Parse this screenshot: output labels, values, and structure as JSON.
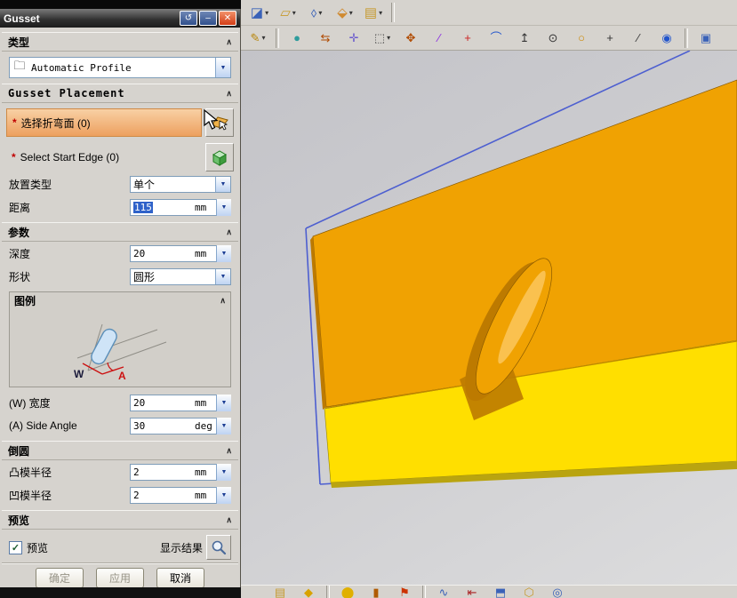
{
  "window": {
    "title": "Gusset"
  },
  "titlebar": {
    "rollback": "↺",
    "minimize": "–",
    "close": "✕"
  },
  "icons": {
    "collapse": "∧",
    "spinner": "▼",
    "check": "✓"
  },
  "dialog": {
    "sections": {
      "type": {
        "header": "类型"
      },
      "placement": {
        "header": "Gusset Placement"
      },
      "parameters": {
        "header": "参数"
      },
      "fillet": {
        "header": "倒圆"
      },
      "preview": {
        "header": "预览"
      }
    },
    "type_combo": {
      "value": "Automatic Profile"
    },
    "select_bend_face": {
      "marker": "*",
      "label": "选择折弯面 (0)"
    },
    "select_start_edge": {
      "marker": "*",
      "label": "Select Start Edge (0)"
    },
    "placement_type": {
      "label": "放置类型",
      "value": "单个"
    },
    "distance": {
      "label": "距离",
      "value": "115",
      "unit": "mm"
    },
    "depth": {
      "label": "深度",
      "value": "20",
      "unit": "mm"
    },
    "shape": {
      "label": "形状",
      "value": "圆形"
    },
    "legend": {
      "label": "图例",
      "w_letter": "W",
      "a_letter": "A"
    },
    "width": {
      "label": "(W) 宽度",
      "value": "20",
      "unit": "mm"
    },
    "side_angle": {
      "label": "(A) Side Angle",
      "value": "30",
      "unit": "deg"
    },
    "punch_radius": {
      "label": "凸模半径",
      "value": "2",
      "unit": "mm"
    },
    "die_radius": {
      "label": "凹模半径",
      "value": "2",
      "unit": "mm"
    },
    "preview_check": {
      "label": "预览"
    },
    "show_result": {
      "label": "显示结果"
    },
    "buttons": {
      "ok": "确定",
      "apply": "应用",
      "cancel": "取消"
    }
  },
  "colors": {
    "face_orange": "#f0a202",
    "face_yellow": "#ffdf00",
    "gusset_dark": "#bd7a00",
    "gusset_highlight": "#ffd27a",
    "edge_blue": "#4d5fd0",
    "thickness": "#b9a410",
    "bend_line": "#c08a00",
    "edge_dark": "#8a5a00"
  },
  "toolbar1": {
    "items": [
      {
        "name": "task-environment-icon",
        "glyph": "◪",
        "color": "#3a62b8",
        "arrow": true
      },
      {
        "name": "datum-plane-icon",
        "glyph": "▱",
        "color": "#c69a2e",
        "arrow": true
      },
      {
        "name": "datum-csys-icon",
        "glyph": "⬨",
        "color": "#3a62b8",
        "arrow": true
      },
      {
        "name": "extrude-icon",
        "glyph": "⬙",
        "color": "#d08a30",
        "arrow": true
      },
      {
        "name": "sheet-stack-icon",
        "glyph": "▤",
        "color": "#c69a2e",
        "arrow": true
      },
      {
        "sep": true
      }
    ]
  },
  "toolbar2": {
    "items": [
      {
        "name": "sketch-icon",
        "glyph": "✎",
        "color": "#b8860b",
        "arrow": true
      },
      {
        "sep": true
      },
      {
        "name": "sphere-icon",
        "glyph": "●",
        "color": "#2e9c9c"
      },
      {
        "name": "swap-arrows-icon",
        "glyph": "⇆",
        "color": "#b04a00"
      },
      {
        "name": "snap-point-icon",
        "glyph": "✛",
        "color": "#6a5acd"
      },
      {
        "name": "marquee-select-icon",
        "glyph": "⬚",
        "color": "#444444",
        "arrow": true
      },
      {
        "name": "move-handle-icon",
        "glyph": "✥",
        "color": "#b04a00"
      },
      {
        "name": "line-icon",
        "glyph": "∕",
        "color": "#8a2be2"
      },
      {
        "name": "point-icon",
        "glyph": "+",
        "color": "#cc2222"
      },
      {
        "name": "arc-icon",
        "glyph": "⌒",
        "color": "#2255cc"
      },
      {
        "name": "axis-up-icon",
        "glyph": "↥",
        "color": "#333333"
      },
      {
        "name": "circle-dot-icon",
        "glyph": "⊙",
        "color": "#333333"
      },
      {
        "name": "circle-icon",
        "glyph": "○",
        "color": "#cc8800"
      },
      {
        "name": "plus-icon",
        "glyph": "+",
        "color": "#333333"
      },
      {
        "name": "slash-icon",
        "glyph": "∕",
        "color": "#333333"
      },
      {
        "name": "eye-icon",
        "glyph": "◉",
        "color": "#2255cc"
      },
      {
        "sep": true
      },
      {
        "name": "shaded-view-cube-icon",
        "glyph": "▣",
        "color": "#3a62b8"
      }
    ]
  },
  "toolbar_bottom": {
    "items": [
      {
        "name": "bottom-layers-icon",
        "glyph": "▤",
        "color": "#c69a2e"
      },
      {
        "name": "bottom-pin-icon",
        "glyph": "◆",
        "color": "#d8a200"
      },
      {
        "sep": true
      },
      {
        "name": "bottom-bulb-icon",
        "glyph": "⬤",
        "color": "#e0b000"
      },
      {
        "name": "bottom-note-icon",
        "glyph": "▮",
        "color": "#b05a00"
      },
      {
        "name": "bottom-flag-icon",
        "glyph": "⚑",
        "color": "#cc3300"
      },
      {
        "sep": true
      },
      {
        "name": "bottom-curve-icon",
        "glyph": "∿",
        "color": "#3a62b8"
      },
      {
        "name": "bottom-dim-icon",
        "glyph": "⇤",
        "color": "#aa2222"
      },
      {
        "name": "bottom-box-icon",
        "glyph": "⬒",
        "color": "#3a62b8"
      },
      {
        "name": "bottom-link-icon",
        "glyph": "⬡",
        "color": "#c69a2e"
      },
      {
        "name": "bottom-target-icon",
        "glyph": "◎",
        "color": "#3a62b8"
      }
    ]
  }
}
